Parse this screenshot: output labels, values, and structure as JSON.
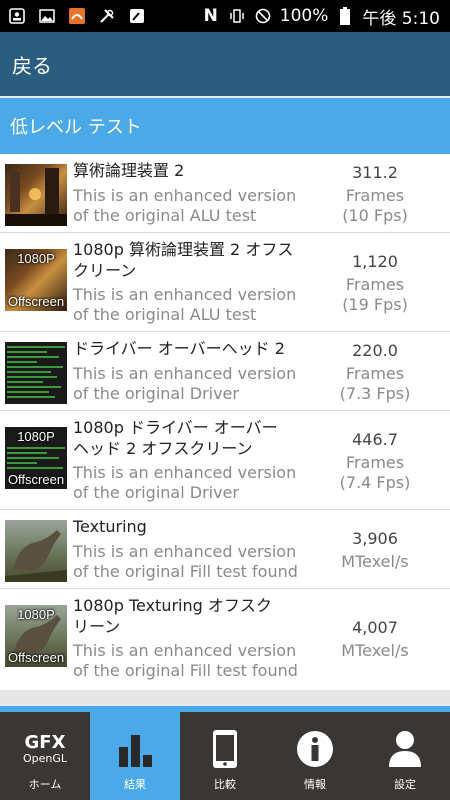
{
  "status_bar": {
    "battery": "100%",
    "time": "午後 5:10"
  },
  "action_bar": {
    "back_label": "戻る"
  },
  "section": {
    "title": "低レベル テスト"
  },
  "tests": [
    {
      "title": "算術論理装置 2",
      "desc1": "This is an enhanced version",
      "desc2": "of the original ALU test",
      "score": "311.2",
      "unit": "Frames",
      "fps": "(10 Fps)",
      "thumb": ""
    },
    {
      "title": "1080p 算術論理装置 2 オフス\nクリーン",
      "desc1": "This is an enhanced version",
      "desc2": "of the original ALU test",
      "score": "1,120",
      "unit": "Frames",
      "fps": "(19 Fps)",
      "thumb_top": "1080P",
      "thumb_bottom": "Offscreen"
    },
    {
      "title": "ドライバー オーバーヘッド 2",
      "desc1": "This is an enhanced version",
      "desc2": "of the original Driver",
      "score": "220.0",
      "unit": "Frames",
      "fps": "(7.3 Fps)"
    },
    {
      "title": "1080p ドライバー オーバー\nヘッド 2 オフスクリーン",
      "desc1": "This is an enhanced version",
      "desc2": "of the original Driver",
      "score": "446.7",
      "unit": "Frames",
      "fps": "(7.4 Fps)",
      "thumb_top": "1080P",
      "thumb_bottom": "Offscreen"
    },
    {
      "title": "Texturing",
      "desc1": "This is an enhanced version",
      "desc2": "of the original Fill test found",
      "score": "3,906",
      "unit": "MTexel/s"
    },
    {
      "title": "1080p Texturing オフスク\nリーン",
      "desc1": "This is an enhanced version",
      "desc2": "of the original Fill test found",
      "score": "4,007",
      "unit": "MTexel/s",
      "thumb_top": "1080P",
      "thumb_bottom": "Offscreen"
    }
  ],
  "bottom_nav": [
    {
      "label": "ホーム",
      "logo_top": "GFX",
      "logo_bottom": "OpenGL"
    },
    {
      "label": "結果"
    },
    {
      "label": "比較"
    },
    {
      "label": "情報"
    },
    {
      "label": "設定"
    }
  ],
  "colors": {
    "accent": "#4aa9e6",
    "header": "#2a5d80",
    "tab_dark": "#3a3633"
  }
}
